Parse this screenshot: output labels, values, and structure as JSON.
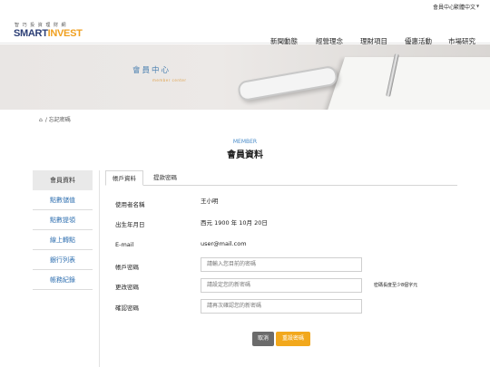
{
  "topbar": {
    "member_link": "會員中心",
    "language": "繁體中文",
    "language_caret": "▼"
  },
  "brand": {
    "tagline": "智 巧 投 資 理 財 網",
    "name_part1": "SMART",
    "name_part2": "INVEST",
    "brand_color": "#2c3e75",
    "accent_color": "#f0a020"
  },
  "nav": {
    "items": [
      "新聞動態",
      "經營理念",
      "理財項目",
      "優惠活動",
      "市場研究"
    ]
  },
  "banner": {
    "title": "會員中心",
    "subtitle": "member center"
  },
  "breadcrumb": {
    "home_icon": "home-icon",
    "current": "忘記密碼"
  },
  "page": {
    "heading_en": "MEMBER",
    "heading_zh": "會員資料"
  },
  "sidebar": {
    "items": [
      "會員資料",
      "點數儲值",
      "點數提領",
      "線上轉點",
      "銀行列表",
      "帳務紀錄"
    ],
    "active_index": 0
  },
  "tabs": {
    "items": [
      "帳戶資料",
      "提款密碼"
    ],
    "active_index": 0
  },
  "form": {
    "username_label": "使用者名稱",
    "username_value": "王小明",
    "birthday_label": "出生年月日",
    "birthday_value": "西元 1900 年 10月 20日",
    "email_label": "E-mail",
    "email_value": "user@mail.com",
    "password_label": "帳戶密碼",
    "password_placeholder": "請輸入您目前的密碼",
    "new_password_label": "更改密碼",
    "new_password_placeholder": "請設定您的新密碼",
    "new_password_hint": "密碼長度至少8個字元",
    "confirm_label": "確認密碼",
    "confirm_placeholder": "請再次確認您的新密碼"
  },
  "buttons": {
    "cancel": "取消",
    "submit": "重設密碼"
  },
  "colors": {
    "link_blue": "#2e6fb0",
    "submit_orange": "#f2a81c",
    "cancel_gray": "#6b6b6b"
  }
}
